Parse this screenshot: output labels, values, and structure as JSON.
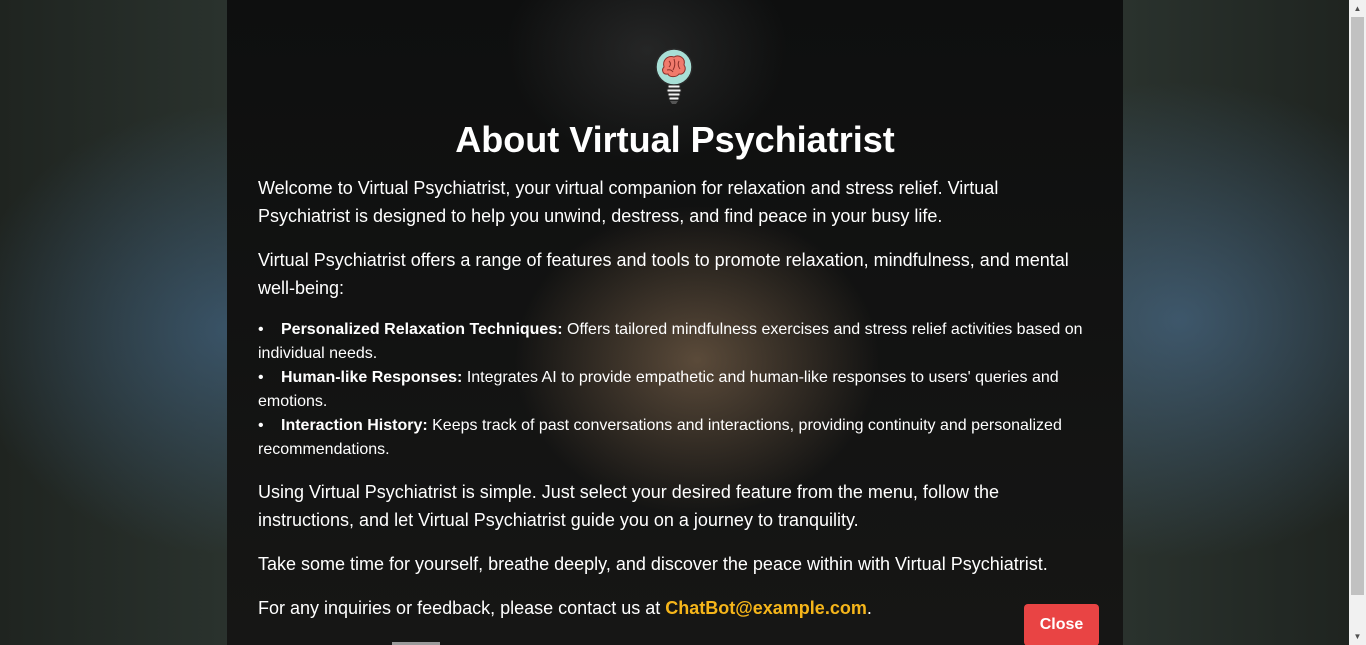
{
  "modal": {
    "title": "About Virtual Psychiatrist",
    "logo_icon": "brain-lightbulb-icon",
    "paragraphs": [
      "Welcome to Virtual Psychiatrist, your virtual companion for relaxation and stress relief. Virtual Psychiatrist is designed to help you unwind, destress, and find peace in your busy life.",
      "Virtual Psychiatrist offers a range of features and tools to promote relaxation, mindfulness, and mental well-being:"
    ],
    "features": [
      {
        "title": "Personalized Relaxation Techniques:",
        "text": " Offers tailored mindfulness exercises and stress relief activities based on individual needs."
      },
      {
        "title": "Human-like Responses:",
        "text": " Integrates AI to provide empathetic and human-like responses to users' queries and emotions."
      },
      {
        "title": "Interaction History:",
        "text": " Keeps track of past conversations and interactions, providing continuity and personalized recommendations."
      }
    ],
    "closing_paragraphs": [
      "Using Virtual Psychiatrist is simple. Just select your desired feature from the menu, follow the instructions, and let Virtual Psychiatrist guide you on a journey to tranquility.",
      "Take some time for yourself, breathe deeply, and discover the peace within with Virtual Psychiatrist."
    ],
    "contact_prefix": "For any inquiries or feedback, please contact us at ",
    "contact_email": "ChatBot@example.com",
    "contact_suffix": ".",
    "close_label": "Close"
  },
  "colors": {
    "accent_email": "#f5b51a",
    "close_button": "#e94444",
    "modal_background": "#111111"
  }
}
